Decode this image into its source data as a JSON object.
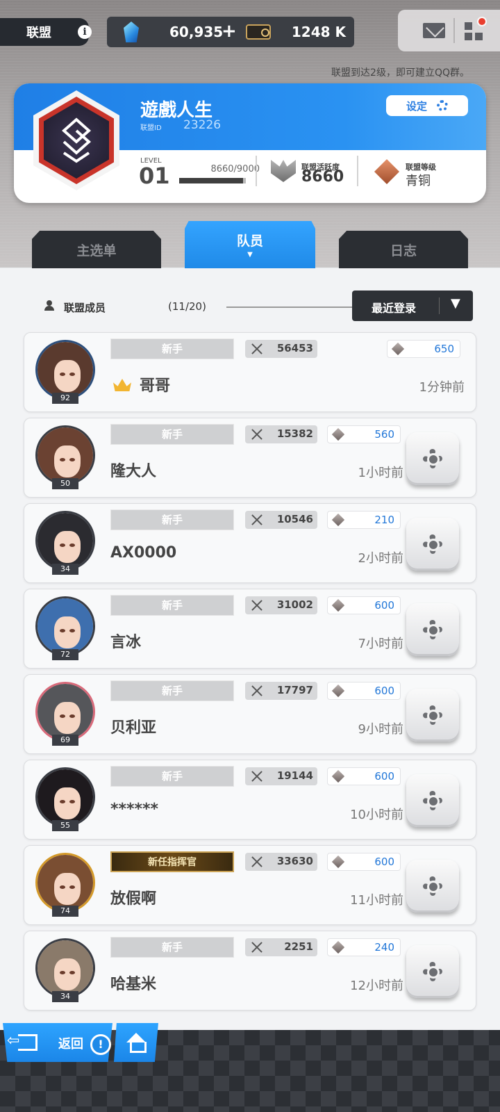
{
  "top": {
    "alliance_label": "联盟",
    "gems": "60,935",
    "plus": "+",
    "tickets": "1248 K",
    "notice": "联盟到达2级，即可建立QQ群。"
  },
  "alliance": {
    "name": "遊戲人生",
    "id_label": "联盟ID",
    "id": "23226",
    "settings_label": "设定",
    "level_label": "LEVEL",
    "level": "01",
    "exp": "8660/9000",
    "exp_progress": 0.962,
    "activity_label": "联盟活跃度",
    "activity": "8660",
    "rank_label": "联盟等级",
    "rank": "青铜"
  },
  "tabs": [
    {
      "label": "主选单",
      "active": false
    },
    {
      "label": "队员",
      "active": true
    },
    {
      "label": "日志",
      "active": false
    }
  ],
  "members_header": {
    "label": "联盟成员",
    "count": "(11/20)",
    "sort": "最近登录"
  },
  "members": [
    {
      "name": "哥哥",
      "title": "新手",
      "power": "56453",
      "contribution": "650",
      "time": "1分钟前",
      "level": "92",
      "leader": true
    },
    {
      "name": "隆大人",
      "title": "新手",
      "power": "15382",
      "contribution": "560",
      "time": "1小时前",
      "level": "50"
    },
    {
      "name": "AX0000",
      "title": "新手",
      "power": "10546",
      "contribution": "210",
      "time": "2小时前",
      "level": "34"
    },
    {
      "name": "言冰",
      "title": "新手",
      "power": "31002",
      "contribution": "600",
      "time": "7小时前",
      "level": "72"
    },
    {
      "name": "贝利亚",
      "title": "新手",
      "power": "17797",
      "contribution": "600",
      "time": "9小时前",
      "level": "69"
    },
    {
      "name": "******",
      "title": "新手",
      "power": "19144",
      "contribution": "600",
      "time": "10小时前",
      "level": "55"
    },
    {
      "name": "放假啊",
      "title": "新任指挥官",
      "power": "33630",
      "contribution": "600",
      "time": "11小时前",
      "level": "74"
    },
    {
      "name": "哈基米",
      "title": "新手",
      "power": "2251",
      "contribution": "240",
      "time": "12小时前",
      "level": "34"
    }
  ],
  "bottom": {
    "back_label": "返回",
    "alert": "!"
  },
  "colors": {
    "accent_blue": "#1f8ae8",
    "contribution_blue": "#2277d8",
    "dark_panel": "#2b2e33"
  }
}
